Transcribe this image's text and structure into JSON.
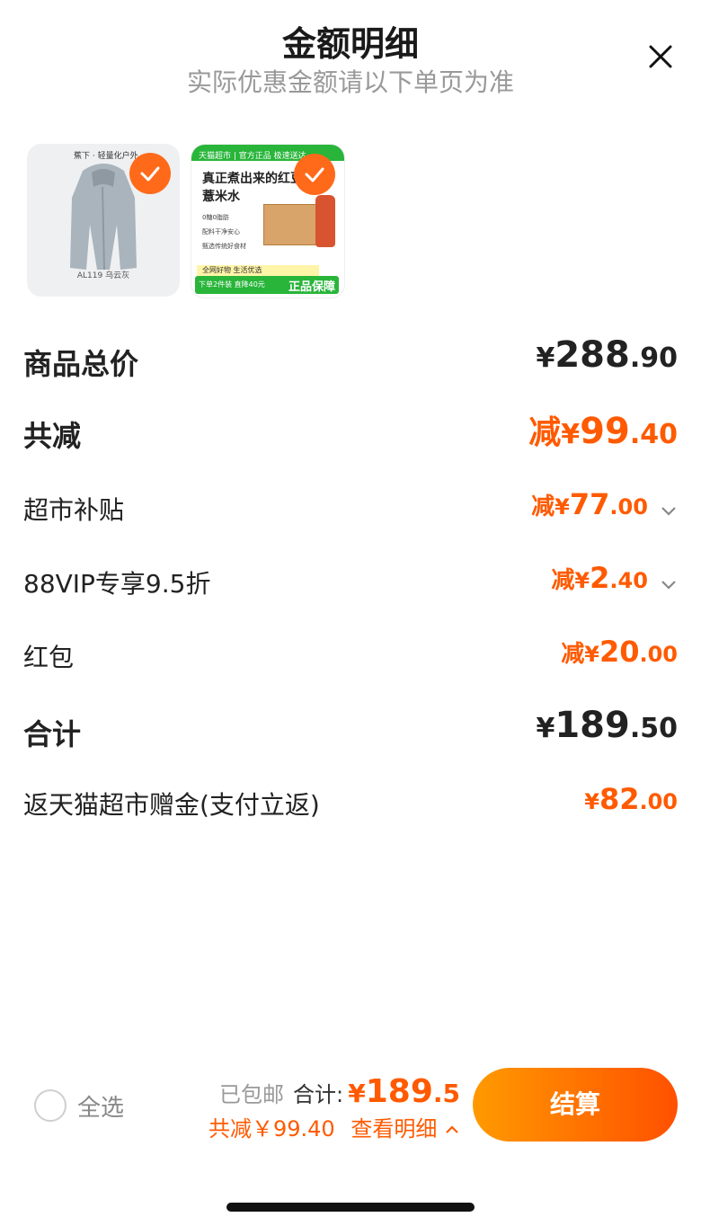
{
  "header": {
    "title": "金额明细",
    "subtitle": "实际优惠金额请以下单页为准"
  },
  "products": [
    {
      "name": "jacket",
      "brand": "蕉下 · 轻量化户外",
      "caption": "AL119 乌云灰",
      "selected": true
    },
    {
      "name": "red-bean-drink",
      "tag": "天猫超市 | 官方正品 极速送达",
      "title": "真正煮出来的红豆薏米水",
      "features": [
        "0糖0脂肪",
        "配料干净安心",
        "甄选传统好食材"
      ],
      "strip": "全网好物 生活优选",
      "promo": "下单2件装 直降40元",
      "badge": "正品保障",
      "selected": true
    }
  ],
  "rows": {
    "goods_total": {
      "label": "商品总价",
      "currency": "¥",
      "int": "288",
      "dec": ".90"
    },
    "total_discount": {
      "label": "共减",
      "prefix": "减",
      "currency": "¥",
      "int": "99",
      "dec": ".40"
    },
    "supermarket_subsidy": {
      "label": "超市补贴",
      "prefix": "减",
      "currency": "¥",
      "int": "77",
      "dec": ".00"
    },
    "vip_discount": {
      "label": "88VIP专享9.5折",
      "prefix": "减",
      "currency": "¥",
      "int": "2",
      "dec": ".40"
    },
    "red_packet": {
      "label": "红包",
      "prefix": "减",
      "currency": "¥",
      "int": "20",
      "dec": ".00"
    },
    "sum": {
      "label": "合计",
      "currency": "¥",
      "int": "189",
      "dec": ".50"
    },
    "cashback": {
      "label": "返天猫超市赠金(支付立返)",
      "currency": "¥",
      "int": "82",
      "dec": ".00"
    }
  },
  "footer": {
    "select_all": "全选",
    "free_shipping": "已包邮",
    "total_label": "合计:",
    "currency": "¥",
    "total_int": "189",
    "total_dec": ".5",
    "discount_text": "共减￥99.40",
    "detail_link": "查看明细",
    "checkout": "结算"
  },
  "colors": {
    "accent": "#ff5a00",
    "text": "#222222",
    "muted": "#999999"
  },
  "icons": {
    "close": "close-icon",
    "check": "check-icon",
    "chevron": "chevron-down-icon",
    "chevron_up": "chevron-up-icon"
  }
}
